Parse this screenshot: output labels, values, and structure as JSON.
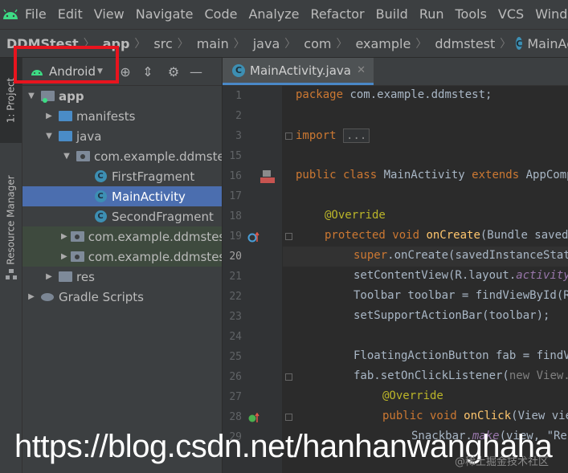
{
  "menu": [
    "File",
    "Edit",
    "View",
    "Navigate",
    "Code",
    "Analyze",
    "Refactor",
    "Build",
    "Run",
    "Tools",
    "VCS",
    "Window"
  ],
  "breadcrumb": [
    "DDMStest",
    "app",
    "src",
    "main",
    "java",
    "com",
    "example",
    "ddmstest",
    "MainActivity"
  ],
  "side_tabs": {
    "project": "1: Project",
    "resource": "Resource Manager"
  },
  "project_view": {
    "selector": "Android"
  },
  "tree": [
    {
      "label": "app"
    },
    {
      "label": "manifests"
    },
    {
      "label": "java"
    },
    {
      "label": "com.example.ddmstest"
    },
    {
      "label": "FirstFragment"
    },
    {
      "label": "MainActivity"
    },
    {
      "label": "SecondFragment"
    },
    {
      "label": "com.example.ddmstest (androidTest)"
    },
    {
      "label": "com.example.ddmstest (test)"
    },
    {
      "label": "res"
    },
    {
      "label": "Gradle Scripts"
    }
  ],
  "editor": {
    "tab": "MainActivity.java",
    "current_line": "20"
  },
  "line_numbers": [
    "1",
    "2",
    "3",
    "15",
    "16",
    "17",
    "18",
    "19",
    "20",
    "21",
    "22",
    "23",
    "24",
    "25",
    "26",
    "27",
    "28",
    "29"
  ],
  "code": {
    "l1_kw": "package ",
    "l1_rest": "com.example.ddmstest;",
    "l3_kw": "import ",
    "l3_fold": "...",
    "l16_kw1": "public class ",
    "l16_name": "MainActivity ",
    "l16_kw2": "extends ",
    "l16_rest": "AppCompatActivity {",
    "l18_ann": "@Override",
    "l19_kw": "protected void ",
    "l19_fn": "onCreate",
    "l19_rest": "(Bundle savedInstanceState) {",
    "l20_kw": "super",
    "l20_rest": ".onCreate(savedInstanceState);",
    "l21_a": "setContentView(R.layout.",
    "l21_b": "activity_main",
    "l21_c": ");",
    "l22": "Toolbar toolbar = findViewById(R.id.toolbar);",
    "l23": "setSupportActionBar(toolbar);",
    "l25": "FloatingActionButton fab = findViewById(R.id.fab);",
    "l26_a": "fab.setOnClickListener(",
    "l26_b": "new View.OnClickListener() {",
    "l27_ann": "@Override",
    "l28_kw": "public void ",
    "l28_fn": "onClick",
    "l28_rest": "(View view) {",
    "l29_a": "Snackbar.",
    "l29_b": "make",
    "l29_c": "(view, \"Replace with your own action\""
  },
  "watermark": {
    "main": "https://blog.csdn.net/hanhanwanghaha",
    "small": "@稀土掘金技术社区"
  },
  "colors": {
    "selection": "#4b6eaf",
    "accent_red": "#e8141e",
    "keyword": "#cc7832",
    "annotation": "#bbb529",
    "method": "#ffc66d"
  }
}
